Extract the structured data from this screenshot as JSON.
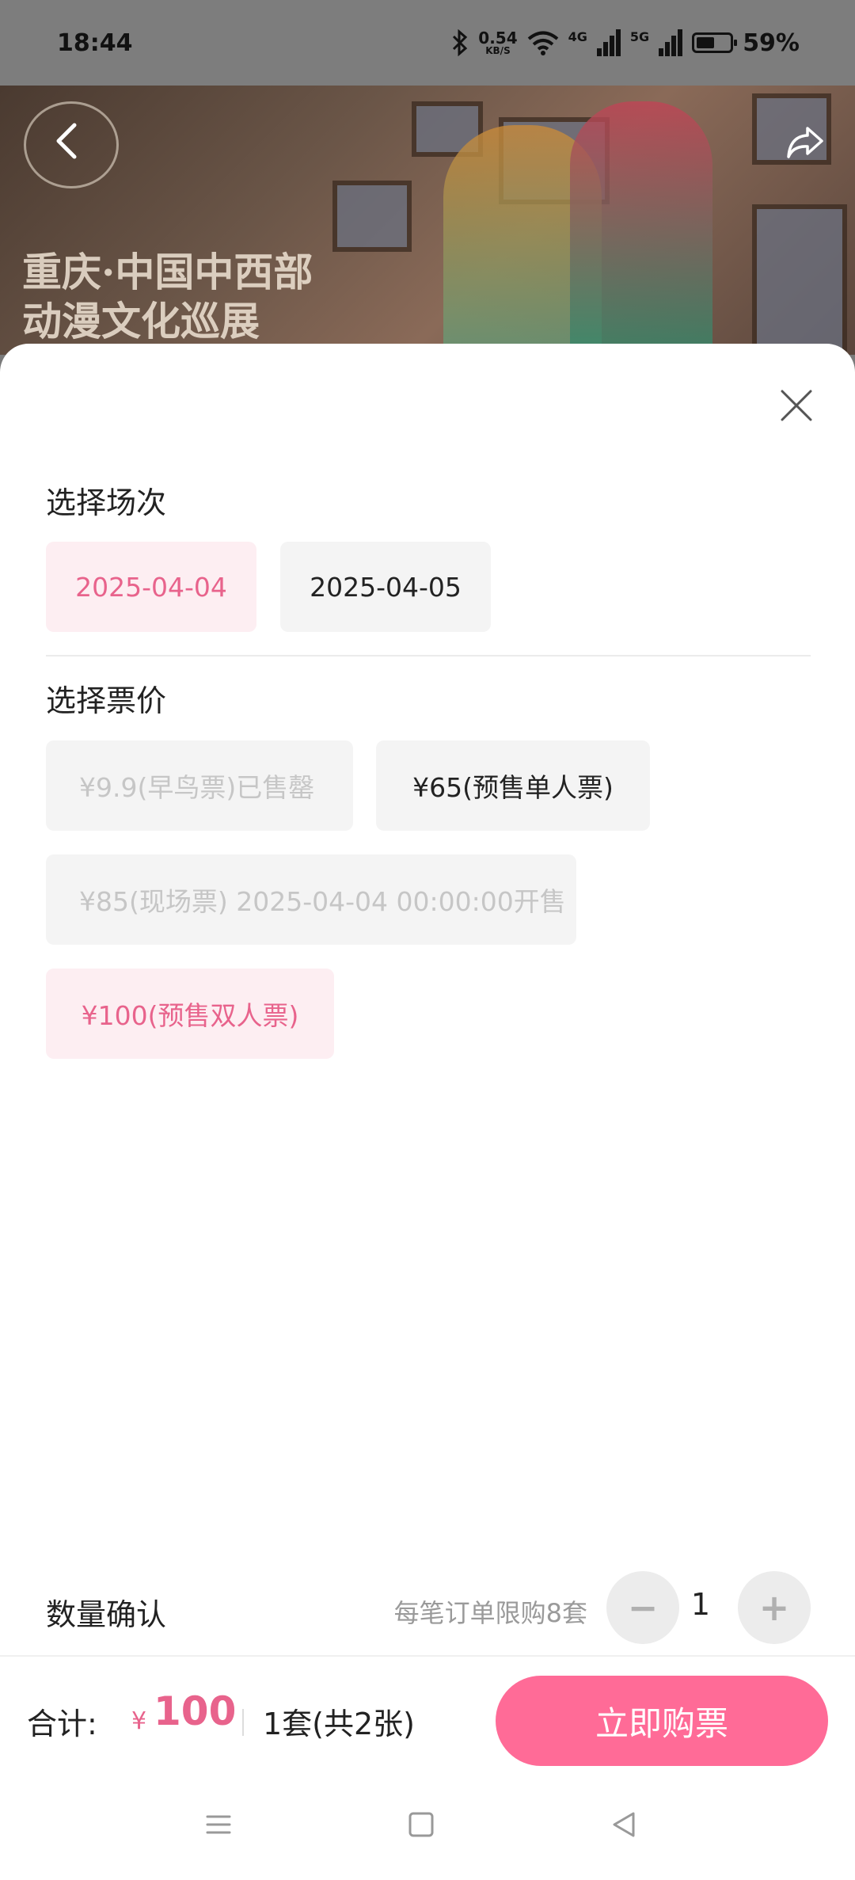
{
  "status_bar": {
    "time": "18:44",
    "net_speed": "0.54",
    "net_unit": "KB/S",
    "sig1": "4G",
    "sig2": "5G",
    "battery": "59%"
  },
  "banner": {
    "title_line1": "重庆·中国中西部",
    "title_line2": "动漫文化巡展"
  },
  "sheet": {
    "session_title": "选择场次",
    "sessions": [
      {
        "label": "2025-04-04",
        "state": "selected"
      },
      {
        "label": "2025-04-05",
        "state": "normal"
      }
    ],
    "price_title": "选择票价",
    "prices": [
      {
        "label": "¥9.9(早鸟票)已售罄",
        "state": "disabled"
      },
      {
        "label": "¥65(预售单人票)",
        "state": "normal"
      },
      {
        "label": "¥85(现场票) 2025-04-04 00:00:00开售",
        "state": "disabled"
      },
      {
        "label": "¥100(预售双人票)",
        "state": "selected"
      }
    ]
  },
  "quantity": {
    "label": "数量确认",
    "limit": "每笔订单限购8套",
    "minus": "−",
    "plus": "+",
    "value": "1"
  },
  "footer": {
    "total_label": "合计:",
    "currency": "¥",
    "total_value": "100",
    "summary": "1套(共2张)",
    "buy_label": "立即购票"
  },
  "colors": {
    "accent": "#ff6b97",
    "selected_text": "#e8638c",
    "selected_bg": "#fdeef2"
  }
}
